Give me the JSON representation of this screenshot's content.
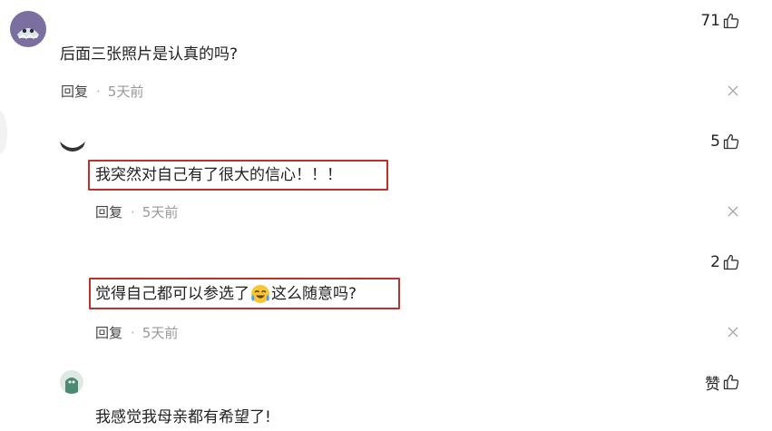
{
  "comments": [
    {
      "text": "后面三张照片是认真的吗?",
      "reply_label": "回复",
      "time": "5天前",
      "likes": "71"
    },
    {
      "text": "我突然对自己有了很大的信心！！！",
      "reply_label": "回复",
      "time": "5天前",
      "likes": "5"
    },
    {
      "text_before_emoji": "觉得自己都可以参选了",
      "text_after_emoji": "这么随意吗?",
      "reply_label": "回复",
      "time": "5天前",
      "likes": "2"
    },
    {
      "text": "我感觉我母亲都有希望了!",
      "likes": "赞"
    }
  ],
  "colors": {
    "highlight_border": "#c0302c",
    "meta_time": "#999999"
  },
  "icons": [
    "thumbs-up-icon",
    "close-icon",
    "crying-laughing-emoji"
  ]
}
